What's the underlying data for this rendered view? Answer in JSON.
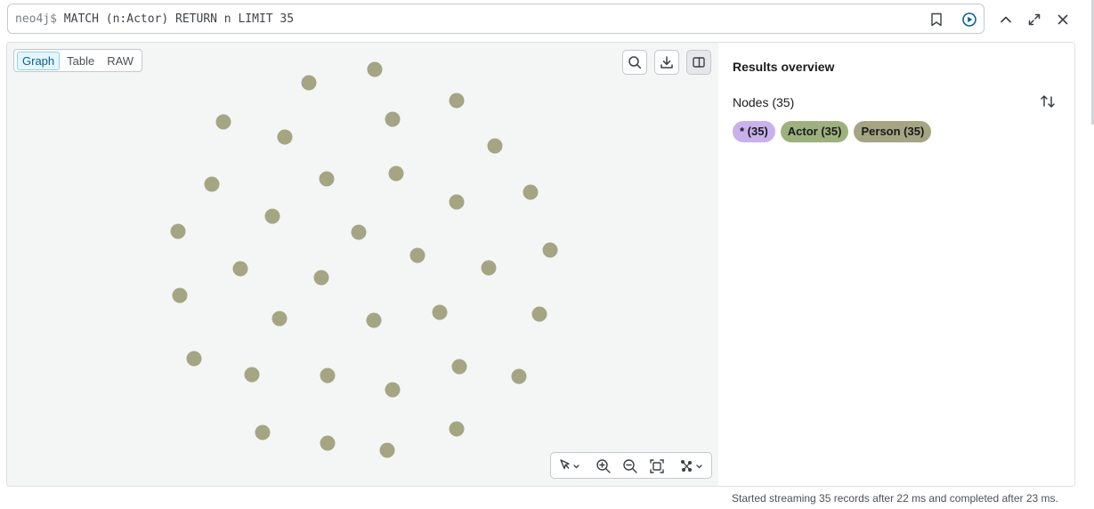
{
  "editor": {
    "prompt": "neo4j$",
    "query": "MATCH (n:Actor) RETURN n LIMIT 35"
  },
  "view_tabs": [
    {
      "label": "Graph",
      "active": true
    },
    {
      "label": "Table",
      "active": false
    },
    {
      "label": "RAW",
      "active": false
    }
  ],
  "toolbar_icons": [
    "search-icon",
    "download-icon",
    "side-panel-icon"
  ],
  "bottom_tools": [
    "select-pointer-icon",
    "zoom-in-icon",
    "zoom-out-icon",
    "fit-to-screen-icon",
    "layout-icon"
  ],
  "graph": {
    "node_color": "#a5a584",
    "node_count": 35
  },
  "sidebar": {
    "title": "Results overview",
    "nodes_label": "Nodes (35)",
    "labels": [
      {
        "text": "* (35)",
        "color": "#c9b1ee"
      },
      {
        "text": "Actor (35)",
        "color": "#9db17e"
      },
      {
        "text": "Person (35)",
        "color": "#a5a584"
      }
    ]
  },
  "status": "Started streaming 35 records after 22 ms and completed after 23 ms.",
  "colors": {
    "accent": "#0a6190",
    "graph_bg": "#f4f5f5",
    "run_icon": "#0a6190"
  }
}
